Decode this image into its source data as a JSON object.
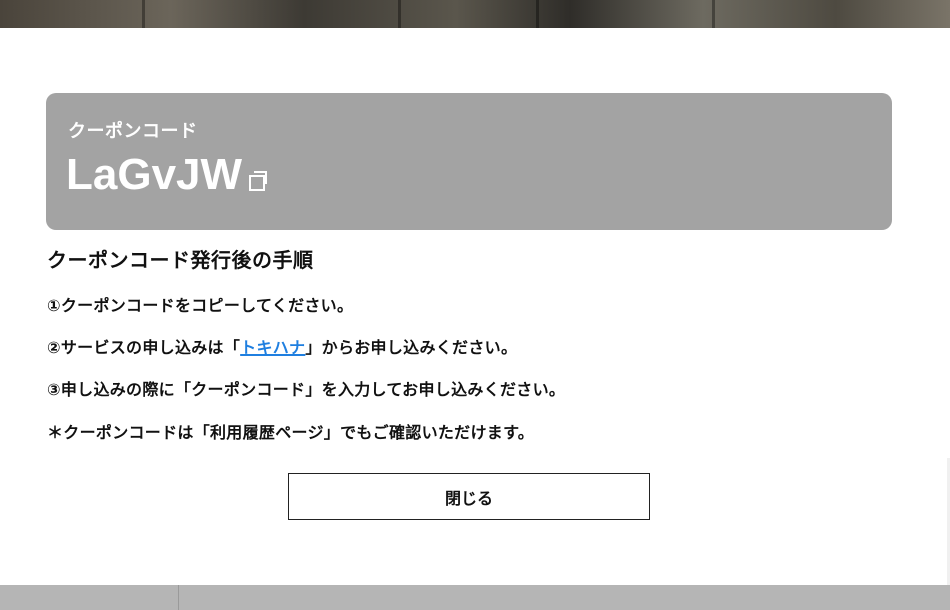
{
  "coupon": {
    "label": "クーポンコード",
    "code": "LaGvJW",
    "copy_icon": "copy-icon"
  },
  "instructions": {
    "title": "クーポンコード発行後の手順",
    "step1": "①クーポンコードをコピーしてください。",
    "step2_prefix": "②サービスの申し込みは「",
    "step2_link": "トキハナ",
    "step2_suffix": "」からお申し込みください。",
    "step3": "③申し込みの際に「クーポンコード」を入力してお申し込みください。",
    "note": "＊クーポンコードは「利用履歴ページ」でもご確認いただけます。"
  },
  "actions": {
    "close_label": "閉じる"
  },
  "colors": {
    "card_background": "#a3a3a3",
    "link": "#1f7fe0",
    "text": "#111111"
  }
}
